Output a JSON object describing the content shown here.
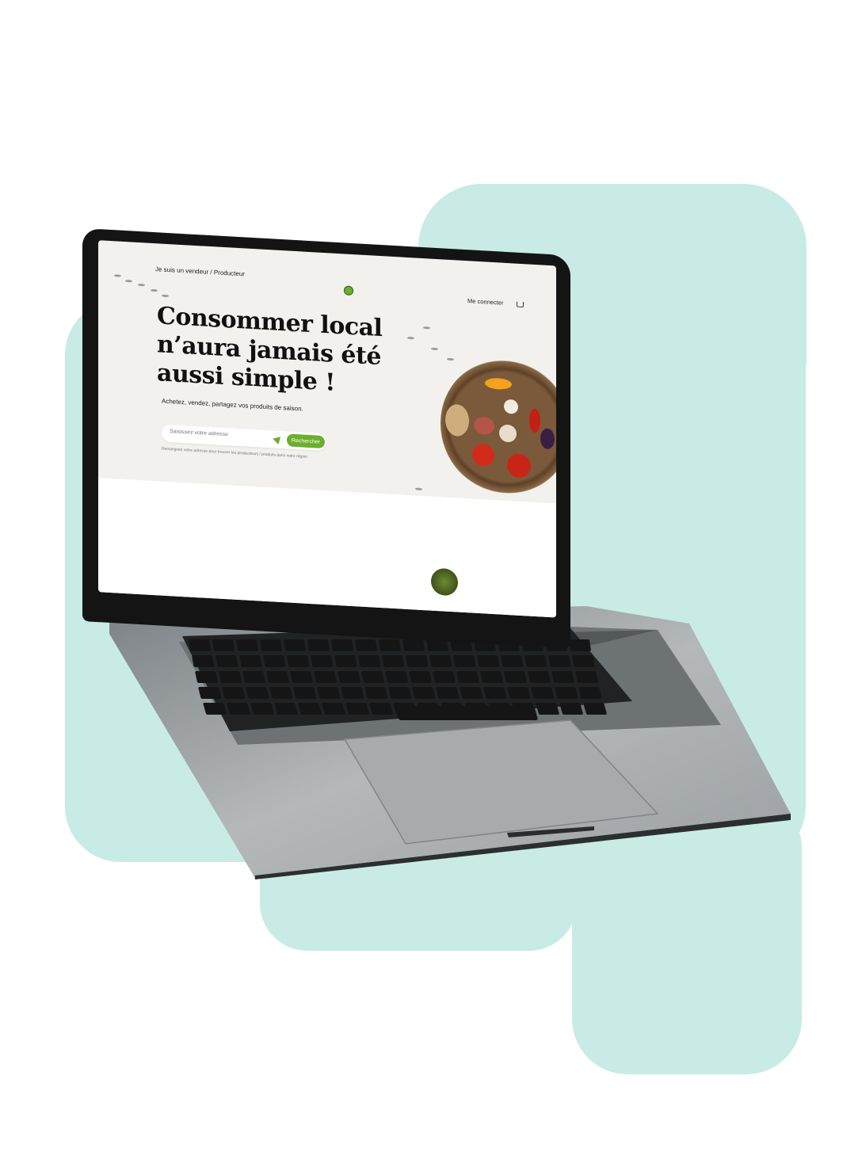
{
  "colors": {
    "background_blob": "#c9ebe5",
    "brand_green": "#6cae2d",
    "laptop_body": "#9aa0a4"
  },
  "header": {
    "seller_link": "Je suis un vendeur / Producteur",
    "login_link": "Me connecter",
    "logo_icon": "leaf-logo-icon",
    "cart_icon": "cart-icon"
  },
  "hero": {
    "title_lines": [
      "Consommer local",
      "n’aura jamais été",
      "aussi simple !"
    ],
    "subtitle": "Achetez, vendez, partagez vos produits de saison.",
    "search": {
      "placeholder": "Saisissez votre adresse",
      "button_label": "Rechercher",
      "locate_icon": "location-arrow-icon",
      "hint": "Renseignez votre adresse pour trouver les producteurs / produits dans votre région"
    },
    "image": "vegetable-basket"
  }
}
